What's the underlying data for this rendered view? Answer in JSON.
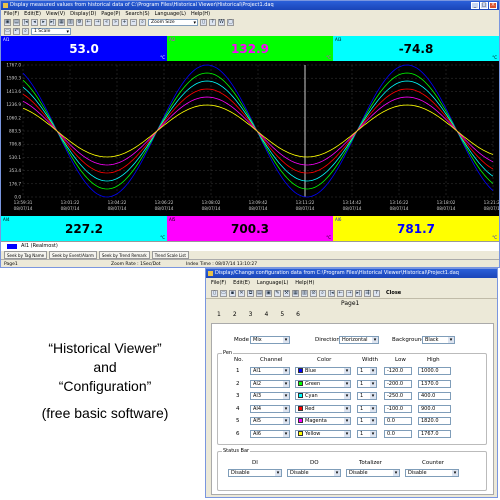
{
  "viewer": {
    "title": "Display measured values from historical data of C:\\Program Files\\Historical Viewer\\Historical\\Project1.daq",
    "menu": [
      "File(F)",
      "Edit(E)",
      "View(V)",
      "Display(D)",
      "Page(P)",
      "Search(S)",
      "Language(L)",
      "Help(H)"
    ],
    "zoom_select": "Zoom Size",
    "scale_select": "1 Scale",
    "panels_top": [
      {
        "label": "AI1",
        "value": "53.0",
        "unit": "°C",
        "color": "#0000ff",
        "text_color": "#ffffff"
      },
      {
        "label": "AI2",
        "value": "132.9",
        "unit": "°C",
        "color": "#00ff00",
        "text_color": "#ff00ff"
      },
      {
        "label": "AI3",
        "value": "-74.8",
        "unit": "°C",
        "color": "#00ffff",
        "text_color": "#000000"
      }
    ],
    "panels_bottom": [
      {
        "label": "AI4",
        "value": "227.2",
        "unit": "°C",
        "color": "#00ffff",
        "text_color": "#000000"
      },
      {
        "label": "AI5",
        "value": "700.3",
        "unit": "°C",
        "color": "#ff00ff",
        "text_color": "#000000"
      },
      {
        "label": "AI6",
        "value": "781.7",
        "unit": "°C",
        "color": "#ffff00",
        "text_color": "#0000ff"
      }
    ],
    "chart_data": {
      "type": "line",
      "ylabels": [
        "1767.0",
        "1590.3",
        "1413.6",
        "1236.9",
        "1060.2",
        "883.5",
        "706.8",
        "530.1",
        "353.4",
        "176.7",
        "0.0"
      ],
      "xlabels": [
        [
          "13:59:31",
          "08/07/14"
        ],
        [
          "13:01:22",
          "08/07/14"
        ],
        [
          "13:04:22",
          "08/07/14"
        ],
        [
          "13:06:22",
          "08/07/14"
        ],
        [
          "13:08:02",
          "08/07/14"
        ],
        [
          "13:09:42",
          "08/07/14"
        ],
        [
          "13:11:22",
          "08/07/14"
        ],
        [
          "13:14:42",
          "08/07/14"
        ],
        [
          "13:16:22",
          "08/07/14"
        ],
        [
          "13:18:02",
          "08/07/14"
        ],
        [
          "13:21:22",
          "08/07/14"
        ]
      ],
      "series": [
        {
          "color": "#0000ff"
        },
        {
          "color": "#00ff00"
        },
        {
          "color": "#00ffff"
        },
        {
          "color": "#ff0000"
        },
        {
          "color": "#ff00ff"
        },
        {
          "color": "#ffff00"
        }
      ],
      "cursor_x_label": "13:11:22"
    },
    "legend": "AI1 (Realmost)",
    "tabs": [
      "Seek by Tag Name",
      "Seek by Event/Alarm",
      "Seek by Trend Remark",
      "Trend Scale List"
    ],
    "status": {
      "page": "Page1",
      "zoom": "Zoom Rate : 1Sec/Dot",
      "index": "Index Time : 08/07/14 13:10:27"
    }
  },
  "caption": {
    "line1": "“Historical Viewer”",
    "line2": "and",
    "line3": "“Configuration”",
    "line4": "(free basic software)"
  },
  "config": {
    "title": "Display/Change configuration data from C:\\Program Files\\Historical Viewer\\Historical\\Project1.daq",
    "menu": [
      "File(F)",
      "Edit(E)",
      "Language(L)",
      "Help(H)"
    ],
    "close_label": "Close",
    "page_title": "Page1",
    "tabs": [
      "1",
      "2",
      "3",
      "4",
      "5",
      "6"
    ],
    "mode_label": "Mode",
    "mode_value": "Mix",
    "direction_label": "Direction",
    "direction_value": "Horizontal",
    "background_label": "Background",
    "background_value": "Black",
    "pen_group": "Pen",
    "headers": [
      "No.",
      "Channel",
      "Color",
      "Width",
      "Low",
      "High"
    ],
    "rows": [
      {
        "no": "1",
        "channel": "AI1",
        "color": "Blue",
        "swatch": "#0000ff",
        "width": "1",
        "low": "-120.0",
        "high": "1000.0"
      },
      {
        "no": "2",
        "channel": "AI2",
        "color": "Green",
        "swatch": "#00ff00",
        "width": "1",
        "low": "-200.0",
        "high": "1370.0"
      },
      {
        "no": "3",
        "channel": "AI3",
        "color": "Cyan",
        "swatch": "#00ffff",
        "width": "1",
        "low": "-250.0",
        "high": "400.0"
      },
      {
        "no": "4",
        "channel": "AI4",
        "color": "Red",
        "swatch": "#ff0000",
        "width": "1",
        "low": "-100.0",
        "high": "900.0"
      },
      {
        "no": "5",
        "channel": "AI5",
        "color": "Magenta",
        "swatch": "#ff00ff",
        "width": "1",
        "low": "0.0",
        "high": "1820.0"
      },
      {
        "no": "6",
        "channel": "AI6",
        "color": "Yellow",
        "swatch": "#ffff00",
        "width": "1",
        "low": "0.0",
        "high": "1767.0"
      }
    ],
    "status_bar_group": "Status Bar",
    "status_headers": [
      "DI",
      "DO",
      "Totalizer",
      "Counter"
    ],
    "status_values": [
      "Disable",
      "Disable",
      "Disable",
      "Disable"
    ]
  }
}
